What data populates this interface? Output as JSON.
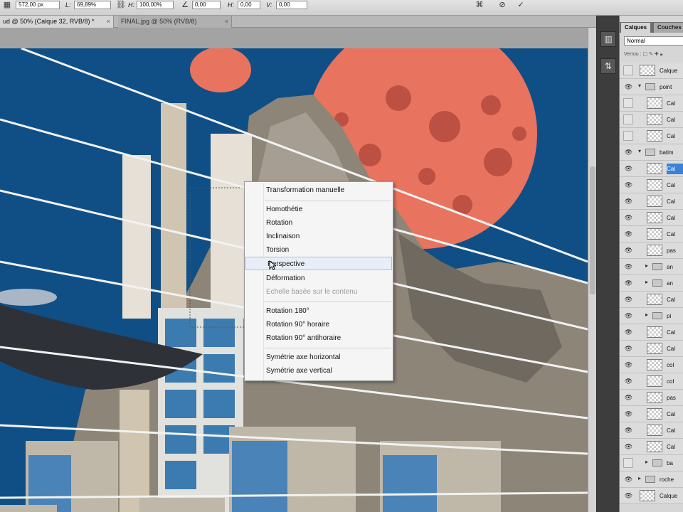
{
  "options_bar": {
    "x_value": "572,00 px",
    "l_label": "L:",
    "width_value": "69,89%",
    "h_label": "H:",
    "height_value": "100,00%",
    "angle_value": "0,00",
    "h_skew_label": "H:",
    "h_skew_value": "0,00",
    "v_skew_label": "V:",
    "v_skew_value": "0,00"
  },
  "tabs": [
    {
      "label": "ud @ 50% (Calque 32, RVB/8) *",
      "active": true
    },
    {
      "label": "FINAL.jpg @ 50% (RVB/8)",
      "active": false
    }
  ],
  "context_menu": {
    "items": [
      {
        "label": "Transformation manuelle",
        "enabled": true
      },
      {
        "label": "Homothétie",
        "enabled": true
      },
      {
        "label": "Rotation",
        "enabled": true
      },
      {
        "label": "Inclinaison",
        "enabled": true
      },
      {
        "label": "Torsion",
        "enabled": true
      },
      {
        "label": "Perspective",
        "enabled": true,
        "hover": true
      },
      {
        "label": "Déformation",
        "enabled": true
      },
      {
        "label": "Echelle basée sur le contenu",
        "enabled": false
      },
      {
        "label": "Rotation 180°",
        "enabled": true
      },
      {
        "label": "Rotation 90° horaire",
        "enabled": true
      },
      {
        "label": "Rotation 90° antihoraire",
        "enabled": true
      },
      {
        "label": "Symétrie axe horizontal",
        "enabled": true
      },
      {
        "label": "Symétrie axe vertical",
        "enabled": true
      }
    ]
  },
  "layers_panel": {
    "tabs": [
      "Calques",
      "Couches"
    ],
    "blend_mode": "Normal",
    "lock_label": "Verrou :",
    "rows": [
      {
        "type": "layer",
        "name": "Calque",
        "visible": false
      },
      {
        "type": "group",
        "name": "point",
        "visible": true,
        "expanded": true
      },
      {
        "type": "layer",
        "name": "Cal",
        "visible": false,
        "indent": true
      },
      {
        "type": "layer",
        "name": "Cal",
        "visible": false,
        "indent": true
      },
      {
        "type": "layer",
        "name": "Cal",
        "visible": false,
        "indent": true
      },
      {
        "type": "group",
        "name": "batim",
        "visible": true,
        "expanded": true
      },
      {
        "type": "layer",
        "name": "Cal",
        "visible": true,
        "indent": true,
        "selected": true
      },
      {
        "type": "layer",
        "name": "Cal",
        "visible": true,
        "indent": true
      },
      {
        "type": "layer",
        "name": "Cal",
        "visible": true,
        "indent": true
      },
      {
        "type": "layer",
        "name": "Cal",
        "visible": true,
        "indent": true
      },
      {
        "type": "layer",
        "name": "Cal",
        "visible": true,
        "indent": true
      },
      {
        "type": "layer",
        "name": "pas",
        "visible": true,
        "indent": true
      },
      {
        "type": "group",
        "name": "an",
        "visible": true,
        "expanded": false,
        "indent": true
      },
      {
        "type": "group",
        "name": "an",
        "visible": true,
        "expanded": false,
        "indent": true
      },
      {
        "type": "layer",
        "name": "Cal",
        "visible": true,
        "indent": true
      },
      {
        "type": "group",
        "name": "pi",
        "visible": true,
        "expanded": false,
        "indent": true
      },
      {
        "type": "layer",
        "name": "Cal",
        "visible": true,
        "indent": true
      },
      {
        "type": "layer",
        "name": "Cal",
        "visible": true,
        "indent": true
      },
      {
        "type": "layer",
        "name": "col",
        "visible": true,
        "indent": true
      },
      {
        "type": "layer",
        "name": "col",
        "visible": true,
        "indent": true
      },
      {
        "type": "layer",
        "name": "pas",
        "visible": true,
        "indent": true
      },
      {
        "type": "layer",
        "name": "Cal",
        "visible": true,
        "indent": true
      },
      {
        "type": "layer",
        "name": "Cal",
        "visible": true,
        "indent": true
      },
      {
        "type": "layer",
        "name": "Cal",
        "visible": true,
        "indent": true
      },
      {
        "type": "group",
        "name": "ba",
        "visible": false,
        "expanded": false,
        "indent": true
      },
      {
        "type": "group",
        "name": "roche",
        "visible": true,
        "expanded": false
      },
      {
        "type": "layer",
        "name": "Calque",
        "visible": true
      }
    ]
  },
  "colors": {
    "sky": "#0f4f86",
    "planet": "#e8735e",
    "menu_bg": "#f5f5f5",
    "selection": "#3b82d6"
  }
}
